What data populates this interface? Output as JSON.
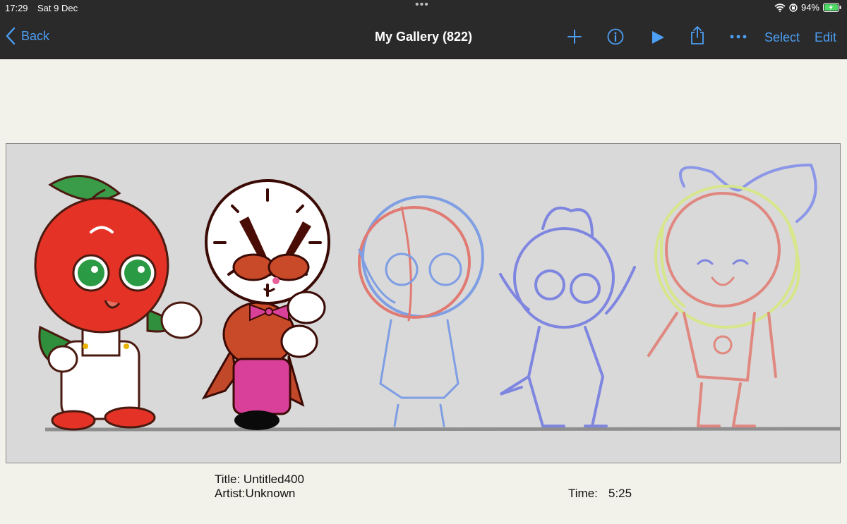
{
  "status_bar": {
    "time": "17:29",
    "date": "Sat 9 Dec",
    "battery": "94%"
  },
  "nav": {
    "back_label": "Back",
    "title": "My Gallery (822)",
    "select_label": "Select",
    "edit_label": "Edit",
    "icons": [
      "add-icon",
      "info-icon",
      "play-icon",
      "share-icon",
      "more-icon"
    ]
  },
  "artwork": {
    "characters": [
      "apple-character",
      "clock-character",
      "blue-sketch-1",
      "blue-sketch-2",
      "red-green-sketch"
    ]
  },
  "info": {
    "title_line": "Title: Untitled400",
    "artist_line": "Artist:Unknown",
    "time_label": "Time:",
    "time_value": "5:25"
  },
  "colors": {
    "accent": "#4c9ff5",
    "bar_bg": "#2a2a2a",
    "page_bg": "#f3f2ea",
    "canvas_bg": "#d9d9d9"
  }
}
